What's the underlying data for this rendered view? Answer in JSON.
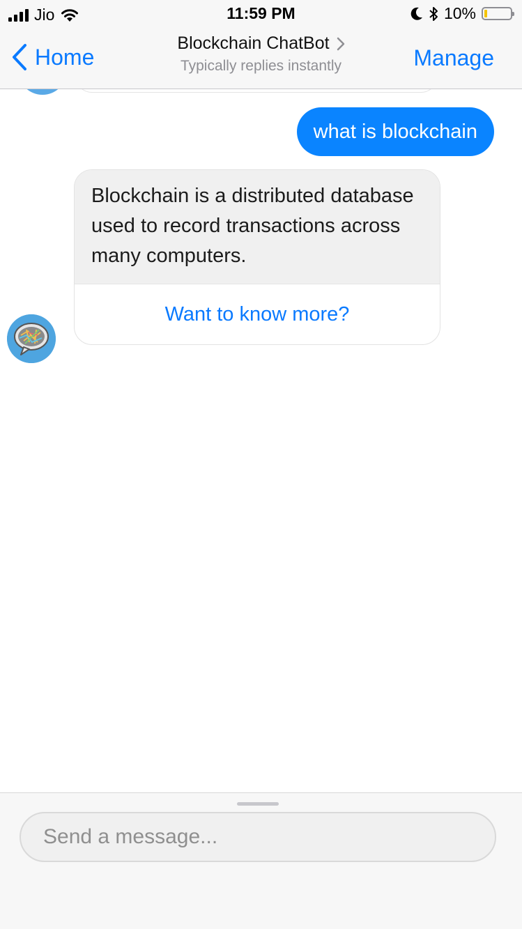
{
  "status_bar": {
    "carrier": "Jio",
    "time": "11:59 PM",
    "battery_percent": "10%",
    "battery_level": 0.1,
    "icons": [
      "signal-icon",
      "wifi-icon",
      "moon-icon",
      "bluetooth-icon",
      "battery-icon"
    ]
  },
  "nav": {
    "back_label": "Home",
    "title": "Blockchain ChatBot",
    "subtitle": "Typically replies instantly",
    "manage_label": "Manage",
    "accent_color": "#0a7aff"
  },
  "messages": {
    "user_text": "what is blockchain",
    "user_bubble_color": "#0a84ff",
    "bot_text": "Blockchain is a distributed database used to record transactions across many computers.",
    "bot_button_label": "Want to know more?"
  },
  "composer": {
    "placeholder": "Send a message..."
  }
}
